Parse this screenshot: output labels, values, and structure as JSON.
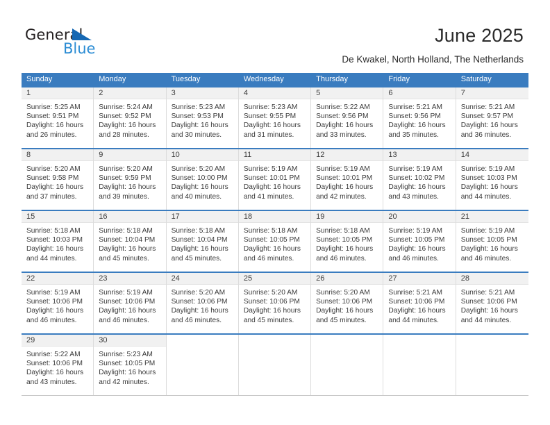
{
  "brand": {
    "name_top": "General",
    "name_bottom": "Blue",
    "accent_color": "#2b8cd4",
    "triangle_color": "#1668b3"
  },
  "header": {
    "title": "June 2025",
    "subtitle": "De Kwakel, North Holland, The Netherlands"
  },
  "calendar": {
    "header_color": "#3a7cbf",
    "weekdays": [
      "Sunday",
      "Monday",
      "Tuesday",
      "Wednesday",
      "Thursday",
      "Friday",
      "Saturday"
    ],
    "weeks": [
      [
        {
          "day": "1",
          "sunrise": "Sunrise: 5:25 AM",
          "sunset": "Sunset: 9:51 PM",
          "daylight": "Daylight: 16 hours and 26 minutes."
        },
        {
          "day": "2",
          "sunrise": "Sunrise: 5:24 AM",
          "sunset": "Sunset: 9:52 PM",
          "daylight": "Daylight: 16 hours and 28 minutes."
        },
        {
          "day": "3",
          "sunrise": "Sunrise: 5:23 AM",
          "sunset": "Sunset: 9:53 PM",
          "daylight": "Daylight: 16 hours and 30 minutes."
        },
        {
          "day": "4",
          "sunrise": "Sunrise: 5:23 AM",
          "sunset": "Sunset: 9:55 PM",
          "daylight": "Daylight: 16 hours and 31 minutes."
        },
        {
          "day": "5",
          "sunrise": "Sunrise: 5:22 AM",
          "sunset": "Sunset: 9:56 PM",
          "daylight": "Daylight: 16 hours and 33 minutes."
        },
        {
          "day": "6",
          "sunrise": "Sunrise: 5:21 AM",
          "sunset": "Sunset: 9:56 PM",
          "daylight": "Daylight: 16 hours and 35 minutes."
        },
        {
          "day": "7",
          "sunrise": "Sunrise: 5:21 AM",
          "sunset": "Sunset: 9:57 PM",
          "daylight": "Daylight: 16 hours and 36 minutes."
        }
      ],
      [
        {
          "day": "8",
          "sunrise": "Sunrise: 5:20 AM",
          "sunset": "Sunset: 9:58 PM",
          "daylight": "Daylight: 16 hours and 37 minutes."
        },
        {
          "day": "9",
          "sunrise": "Sunrise: 5:20 AM",
          "sunset": "Sunset: 9:59 PM",
          "daylight": "Daylight: 16 hours and 39 minutes."
        },
        {
          "day": "10",
          "sunrise": "Sunrise: 5:20 AM",
          "sunset": "Sunset: 10:00 PM",
          "daylight": "Daylight: 16 hours and 40 minutes."
        },
        {
          "day": "11",
          "sunrise": "Sunrise: 5:19 AM",
          "sunset": "Sunset: 10:01 PM",
          "daylight": "Daylight: 16 hours and 41 minutes."
        },
        {
          "day": "12",
          "sunrise": "Sunrise: 5:19 AM",
          "sunset": "Sunset: 10:01 PM",
          "daylight": "Daylight: 16 hours and 42 minutes."
        },
        {
          "day": "13",
          "sunrise": "Sunrise: 5:19 AM",
          "sunset": "Sunset: 10:02 PM",
          "daylight": "Daylight: 16 hours and 43 minutes."
        },
        {
          "day": "14",
          "sunrise": "Sunrise: 5:19 AM",
          "sunset": "Sunset: 10:03 PM",
          "daylight": "Daylight: 16 hours and 44 minutes."
        }
      ],
      [
        {
          "day": "15",
          "sunrise": "Sunrise: 5:18 AM",
          "sunset": "Sunset: 10:03 PM",
          "daylight": "Daylight: 16 hours and 44 minutes."
        },
        {
          "day": "16",
          "sunrise": "Sunrise: 5:18 AM",
          "sunset": "Sunset: 10:04 PM",
          "daylight": "Daylight: 16 hours and 45 minutes."
        },
        {
          "day": "17",
          "sunrise": "Sunrise: 5:18 AM",
          "sunset": "Sunset: 10:04 PM",
          "daylight": "Daylight: 16 hours and 45 minutes."
        },
        {
          "day": "18",
          "sunrise": "Sunrise: 5:18 AM",
          "sunset": "Sunset: 10:05 PM",
          "daylight": "Daylight: 16 hours and 46 minutes."
        },
        {
          "day": "19",
          "sunrise": "Sunrise: 5:18 AM",
          "sunset": "Sunset: 10:05 PM",
          "daylight": "Daylight: 16 hours and 46 minutes."
        },
        {
          "day": "20",
          "sunrise": "Sunrise: 5:19 AM",
          "sunset": "Sunset: 10:05 PM",
          "daylight": "Daylight: 16 hours and 46 minutes."
        },
        {
          "day": "21",
          "sunrise": "Sunrise: 5:19 AM",
          "sunset": "Sunset: 10:05 PM",
          "daylight": "Daylight: 16 hours and 46 minutes."
        }
      ],
      [
        {
          "day": "22",
          "sunrise": "Sunrise: 5:19 AM",
          "sunset": "Sunset: 10:06 PM",
          "daylight": "Daylight: 16 hours and 46 minutes."
        },
        {
          "day": "23",
          "sunrise": "Sunrise: 5:19 AM",
          "sunset": "Sunset: 10:06 PM",
          "daylight": "Daylight: 16 hours and 46 minutes."
        },
        {
          "day": "24",
          "sunrise": "Sunrise: 5:20 AM",
          "sunset": "Sunset: 10:06 PM",
          "daylight": "Daylight: 16 hours and 46 minutes."
        },
        {
          "day": "25",
          "sunrise": "Sunrise: 5:20 AM",
          "sunset": "Sunset: 10:06 PM",
          "daylight": "Daylight: 16 hours and 45 minutes."
        },
        {
          "day": "26",
          "sunrise": "Sunrise: 5:20 AM",
          "sunset": "Sunset: 10:06 PM",
          "daylight": "Daylight: 16 hours and 45 minutes."
        },
        {
          "day": "27",
          "sunrise": "Sunrise: 5:21 AM",
          "sunset": "Sunset: 10:06 PM",
          "daylight": "Daylight: 16 hours and 44 minutes."
        },
        {
          "day": "28",
          "sunrise": "Sunrise: 5:21 AM",
          "sunset": "Sunset: 10:06 PM",
          "daylight": "Daylight: 16 hours and 44 minutes."
        }
      ],
      [
        {
          "day": "29",
          "sunrise": "Sunrise: 5:22 AM",
          "sunset": "Sunset: 10:06 PM",
          "daylight": "Daylight: 16 hours and 43 minutes."
        },
        {
          "day": "30",
          "sunrise": "Sunrise: 5:23 AM",
          "sunset": "Sunset: 10:05 PM",
          "daylight": "Daylight: 16 hours and 42 minutes."
        },
        {
          "day": "",
          "sunrise": "",
          "sunset": "",
          "daylight": ""
        },
        {
          "day": "",
          "sunrise": "",
          "sunset": "",
          "daylight": ""
        },
        {
          "day": "",
          "sunrise": "",
          "sunset": "",
          "daylight": ""
        },
        {
          "day": "",
          "sunrise": "",
          "sunset": "",
          "daylight": ""
        },
        {
          "day": "",
          "sunrise": "",
          "sunset": "",
          "daylight": ""
        }
      ]
    ]
  }
}
